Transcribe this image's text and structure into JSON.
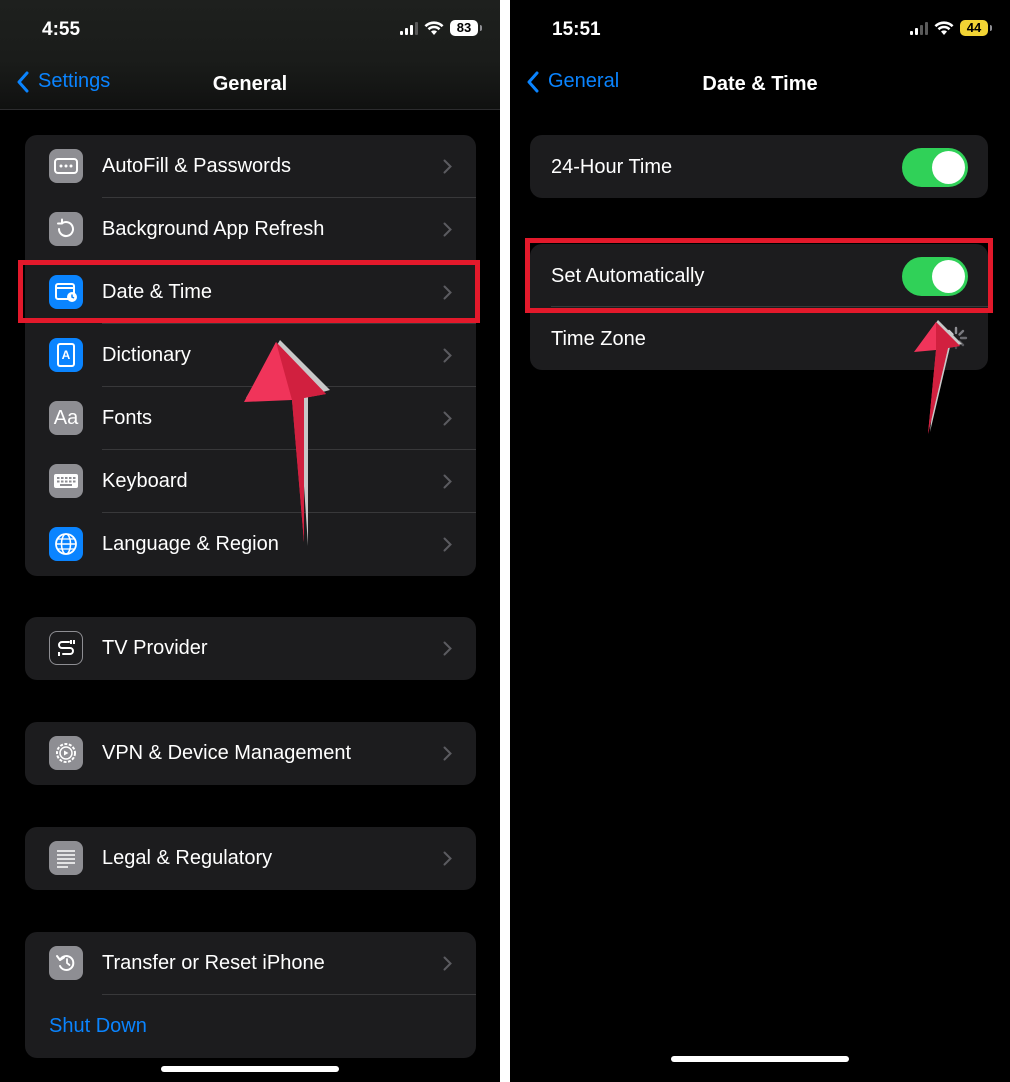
{
  "left": {
    "status": {
      "time": "4:55",
      "battery": "83"
    },
    "nav": {
      "back_label": "Settings",
      "title": "General"
    },
    "group1": [
      {
        "label": "AutoFill & Passwords",
        "icon": "autofill-icon"
      },
      {
        "label": "Background App Refresh",
        "icon": "refresh-icon"
      },
      {
        "label": "Date & Time",
        "icon": "calendar-clock-icon"
      },
      {
        "label": "Dictionary",
        "icon": "dictionary-icon"
      },
      {
        "label": "Fonts",
        "icon": "fonts-icon",
        "glyph": "Aa"
      },
      {
        "label": "Keyboard",
        "icon": "keyboard-icon"
      },
      {
        "label": "Language & Region",
        "icon": "globe-icon"
      }
    ],
    "group2": [
      {
        "label": "TV Provider",
        "icon": "tv-provider-icon"
      }
    ],
    "group3": [
      {
        "label": "VPN & Device Management",
        "icon": "gear-icon"
      }
    ],
    "group4": [
      {
        "label": "Legal & Regulatory",
        "icon": "document-icon"
      }
    ],
    "group5": [
      {
        "label": "Transfer or Reset iPhone",
        "icon": "reset-icon"
      },
      {
        "label": "Shut Down"
      }
    ]
  },
  "right": {
    "status": {
      "time": "15:51",
      "battery": "44"
    },
    "nav": {
      "back_label": "General",
      "title": "Date & Time"
    },
    "group1": [
      {
        "label": "24-Hour Time",
        "on": true
      }
    ],
    "group2": [
      {
        "label": "Set Automatically",
        "on": true
      },
      {
        "label": "Time Zone",
        "loading": true
      }
    ]
  },
  "colors": {
    "accent": "#0a84ff",
    "toggle_on": "#30d158",
    "highlight": "#e3192b",
    "annotation_arrow": "#f0345a"
  }
}
